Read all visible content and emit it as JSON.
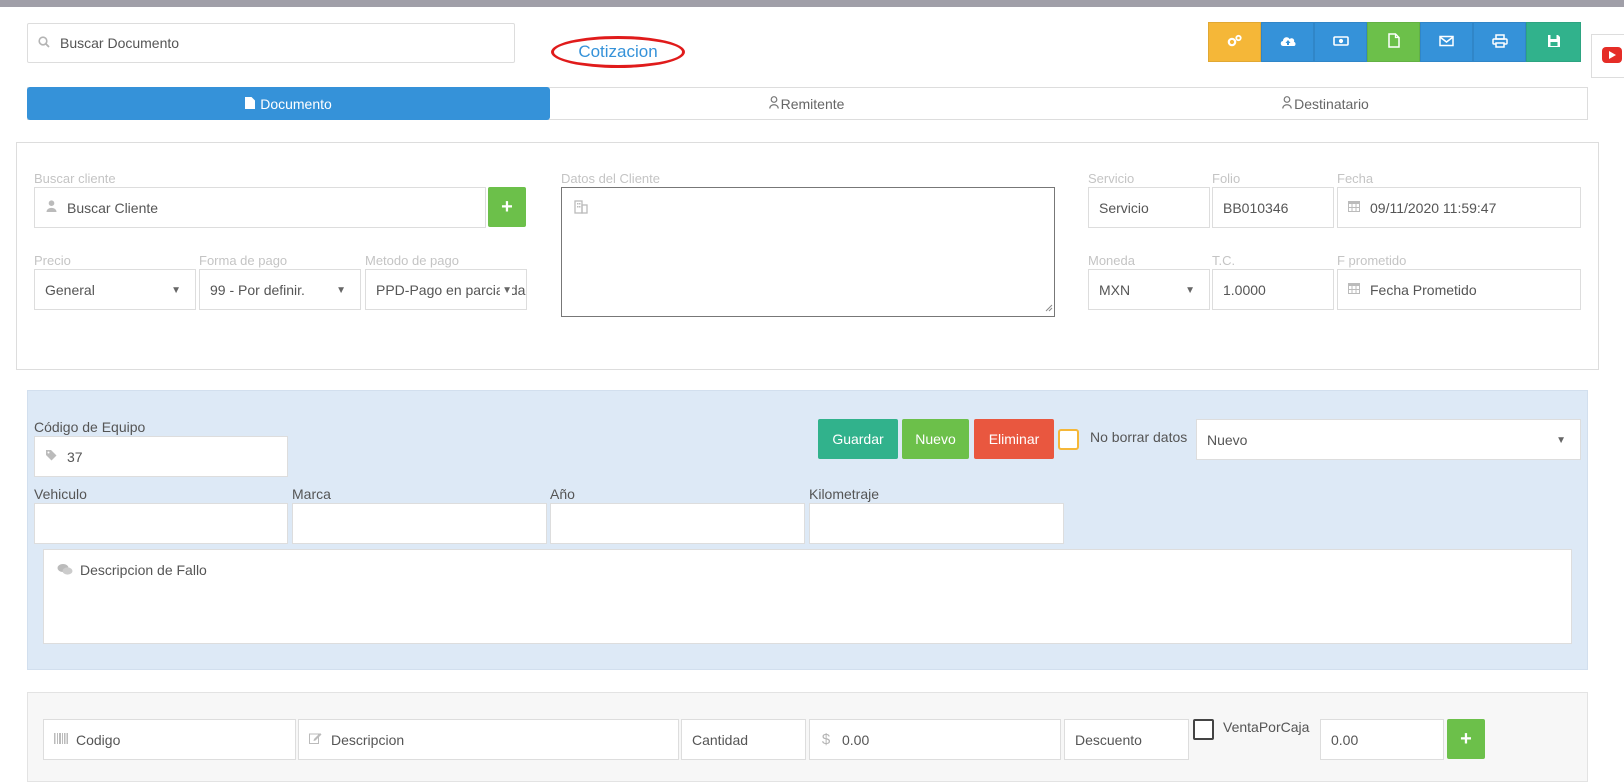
{
  "colors": {
    "orange": "#f5b738",
    "blue": "#3592d9",
    "green": "#6cc04a",
    "teal": "#31b28c",
    "red": "#e9573f",
    "panel": "#dde9f6"
  },
  "header": {
    "search_placeholder": "Buscar Documento",
    "doc_type": "Cotizacion"
  },
  "toolbar": {
    "buttons": [
      {
        "icon": "settings-cogs-icon"
      },
      {
        "icon": "cloud-upload-icon"
      },
      {
        "icon": "money-icon"
      },
      {
        "icon": "file-icon"
      },
      {
        "icon": "email-icon"
      },
      {
        "icon": "print-icon"
      },
      {
        "icon": "save-icon"
      }
    ],
    "side_icon": "youtube-icon"
  },
  "tabs": [
    {
      "label": "Documento",
      "active": true
    },
    {
      "label": "Remitente",
      "active": false
    },
    {
      "label": "Destinatario",
      "active": false
    }
  ],
  "client": {
    "search_label": "Buscar cliente",
    "search_placeholder": "Buscar Cliente",
    "add_button": "+",
    "price_label": "Precio",
    "price_value": "General",
    "payment_form_label": "Forma de pago",
    "payment_form_value": "99 - Por definir.",
    "payment_method_label": "Metodo de pago",
    "payment_method_value": "PPD-Pago en parcialidades",
    "data_label": "Datos del Cliente"
  },
  "doc_info": {
    "service_label": "Servicio",
    "service_placeholder": "Servicio",
    "folio_label": "Folio",
    "folio_value": "BB010346",
    "date_label": "Fecha",
    "date_value": "09/11/2020 11:59:47",
    "currency_label": "Moneda",
    "currency_value": "MXN",
    "tc_label": "T.C.",
    "tc_value": "1.0000",
    "promised_label": "F prometido",
    "promised_placeholder": "Fecha Prometido"
  },
  "equipment": {
    "code_label": "Código de Equipo",
    "code_value": "37",
    "save_button": "Guardar",
    "new_button": "Nuevo",
    "delete_button": "Eliminar",
    "keep_data_label": "No borrar datos",
    "status_value": "Nuevo",
    "vehicle_label": "Vehiculo",
    "brand_label": "Marca",
    "year_label": "Año",
    "mileage_label": "Kilometraje",
    "fault_placeholder": "Descripcion de Fallo"
  },
  "items": {
    "code_placeholder": "Codigo",
    "description_placeholder": "Descripcion",
    "quantity_placeholder": "Cantidad",
    "price_value": "0.00",
    "discount_placeholder": "Descuento",
    "box_sale_label": "VentaPorCaja",
    "total_value": "0.00",
    "add_button": "+"
  }
}
